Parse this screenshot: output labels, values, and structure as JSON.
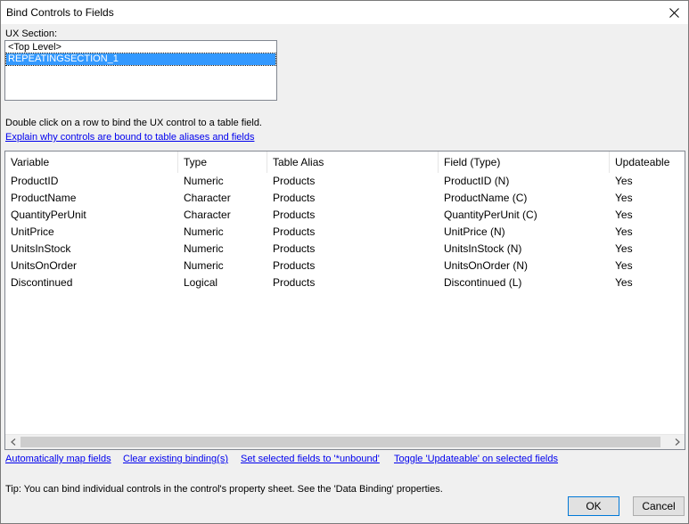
{
  "window": {
    "title": "Bind Controls to Fields"
  },
  "ux_section": {
    "label": "UX Section:",
    "items": [
      {
        "label": "<Top Level>",
        "selected": false
      },
      {
        "label": "REPEATINGSECTION_1",
        "selected": true
      }
    ]
  },
  "instructions": "Double click on a row to bind the UX control to a table field.",
  "explain_link": "Explain why controls are bound to table aliases and fields",
  "grid": {
    "columns": [
      "Variable",
      "Type",
      "Table Alias",
      "Field (Type)",
      "Updateable"
    ],
    "rows": [
      [
        "ProductID",
        "Numeric",
        "Products",
        "ProductID (N)",
        "Yes"
      ],
      [
        "ProductName",
        "Character",
        "Products",
        "ProductName (C)",
        "Yes"
      ],
      [
        "QuantityPerUnit",
        "Character",
        "Products",
        "QuantityPerUnit (C)",
        "Yes"
      ],
      [
        "UnitPrice",
        "Numeric",
        "Products",
        "UnitPrice (N)",
        "Yes"
      ],
      [
        "UnitsInStock",
        "Numeric",
        "Products",
        "UnitsInStock (N)",
        "Yes"
      ],
      [
        "UnitsOnOrder",
        "Numeric",
        "Products",
        "UnitsOnOrder (N)",
        "Yes"
      ],
      [
        "Discontinued",
        "Logical",
        "Products",
        "Discontinued (L)",
        "Yes"
      ]
    ]
  },
  "actions": {
    "auto_map": "Automatically map fields",
    "clear_binding": "Clear existing binding(s)",
    "set_unbound": "Set selected fields to '*unbound'",
    "toggle_updateable": "Toggle 'Updateable' on selected fields"
  },
  "tip": "Tip: You can bind individual controls in the control's property sheet. See the 'Data Binding' properties.",
  "buttons": {
    "ok": "OK",
    "cancel": "Cancel"
  },
  "icons": {
    "close": "close-icon",
    "scroll_left": "chevron-left-icon",
    "scroll_right": "chevron-right-icon"
  },
  "colors": {
    "selection": "#3399ff",
    "link": "#0000ee",
    "window_bg": "#f0f0f0"
  }
}
